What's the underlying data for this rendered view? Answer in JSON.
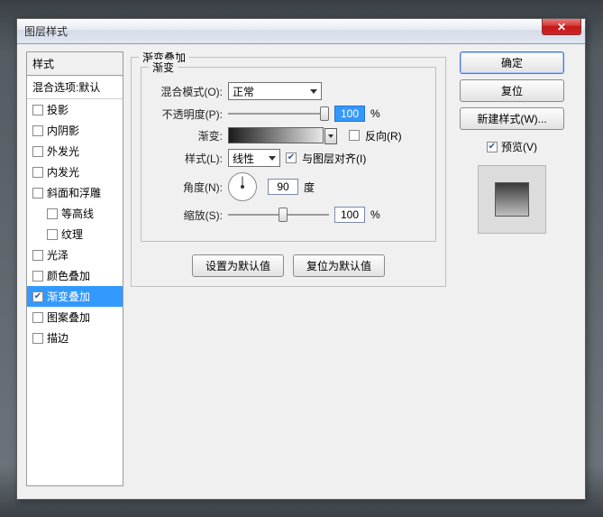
{
  "title": "图层样式",
  "close_glyph": "✕",
  "styles_header": "样式",
  "styles": [
    {
      "label": "混合选项:默认",
      "checked": false,
      "nocb": true
    },
    {
      "label": "投影",
      "checked": false
    },
    {
      "label": "内阴影",
      "checked": false
    },
    {
      "label": "外发光",
      "checked": false
    },
    {
      "label": "内发光",
      "checked": false
    },
    {
      "label": "斜面和浮雕",
      "checked": false
    },
    {
      "label": "等高线",
      "checked": false,
      "indent": true
    },
    {
      "label": "纹理",
      "checked": false,
      "indent": true
    },
    {
      "label": "光泽",
      "checked": false
    },
    {
      "label": "颜色叠加",
      "checked": false
    },
    {
      "label": "渐变叠加",
      "checked": true,
      "selected": true
    },
    {
      "label": "图案叠加",
      "checked": false
    },
    {
      "label": "描边",
      "checked": false
    }
  ],
  "panel": {
    "group_title": "渐变叠加",
    "sub_title": "渐变",
    "blend_label": "混合模式(O):",
    "blend_value": "正常",
    "opacity_label": "不透明度(P):",
    "opacity_value": "100",
    "pct": "%",
    "gradient_label": "渐变:",
    "reverse_label": "反向(R)",
    "style_label": "样式(L):",
    "style_value": "线性",
    "align_label": "与图层对齐(I)",
    "angle_label": "角度(N):",
    "angle_value": "90",
    "angle_unit": "度",
    "scale_label": "缩放(S):",
    "scale_value": "100",
    "set_default": "设置为默认值",
    "reset_default": "复位为默认值"
  },
  "buttons": {
    "ok": "确定",
    "reset": "复位",
    "new_style": "新建样式(W)...",
    "preview": "预览(V)"
  }
}
